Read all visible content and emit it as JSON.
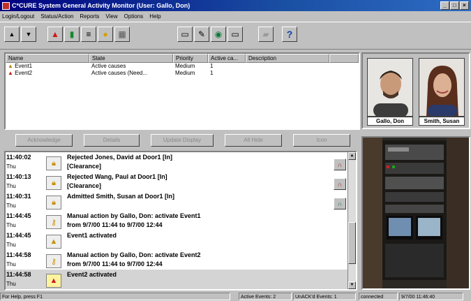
{
  "window": {
    "title": "C*CURE System General Activity Monitor (User: Gallo, Don)"
  },
  "menu": [
    "Login/Logout",
    "Status/Action",
    "Reports",
    "View",
    "Options",
    "Help"
  ],
  "toolbar": {
    "help_glyph": "?"
  },
  "events": {
    "columns": [
      "Name",
      "State",
      "Priority",
      "Active ca...",
      "Description"
    ],
    "rows": [
      {
        "name": "Event1",
        "state": "Active causes",
        "priority": "Medium",
        "active": "1",
        "description": ""
      },
      {
        "name": "Event2",
        "state": "Active causes (Need...",
        "priority": "Medium",
        "active": "1",
        "description": ""
      }
    ]
  },
  "buttons": [
    "Acknowledge",
    "Details",
    "Update Display",
    "All Hide",
    "Icon"
  ],
  "log": [
    {
      "time": "11:40:02",
      "day": "Thu",
      "line1": "Rejected Jones, David at Door1 [In]",
      "line2": "[Clearance]",
      "icon": "lock"
    },
    {
      "time": "11:40:13",
      "day": "Thu",
      "line1": "Rejected Wang, Paul at Door1 [In]",
      "line2": "[Clearance]",
      "icon": "lock"
    },
    {
      "time": "11:40:31",
      "day": "Thu",
      "line1": "Admitted Smith, Susan at Door1 [In]",
      "line2": "",
      "icon": "lock"
    },
    {
      "time": "11:44:45",
      "day": "Thu",
      "line1": "Manual action by Gallo, Don: activate Event1",
      "line2": "from 9/7/00 11:44 to 9/7/00 12:44",
      "icon": "key"
    },
    {
      "time": "11:44:45",
      "day": "Thu",
      "line1": "Event1 activated",
      "line2": "",
      "icon": "event"
    },
    {
      "time": "11:44:58",
      "day": "Thu",
      "line1": "Manual action by Gallo, Don: activate Event2",
      "line2": "from 9/7/00 11:44 to 9/7/00 12:44",
      "icon": "key"
    },
    {
      "time": "11:44:58",
      "day": "Thu",
      "line1": "Event2 activated",
      "line2": "",
      "icon": "alarm"
    }
  ],
  "photos": [
    {
      "name": "Gallo, Don"
    },
    {
      "name": "Smith, Susan"
    }
  ],
  "status": {
    "help": "For Help, press F1",
    "active_events": "Active Events: 2",
    "unacked": "UnACK'd Events: 1",
    "connection": "connected",
    "datetime": "9/7/00 11:46:40"
  }
}
